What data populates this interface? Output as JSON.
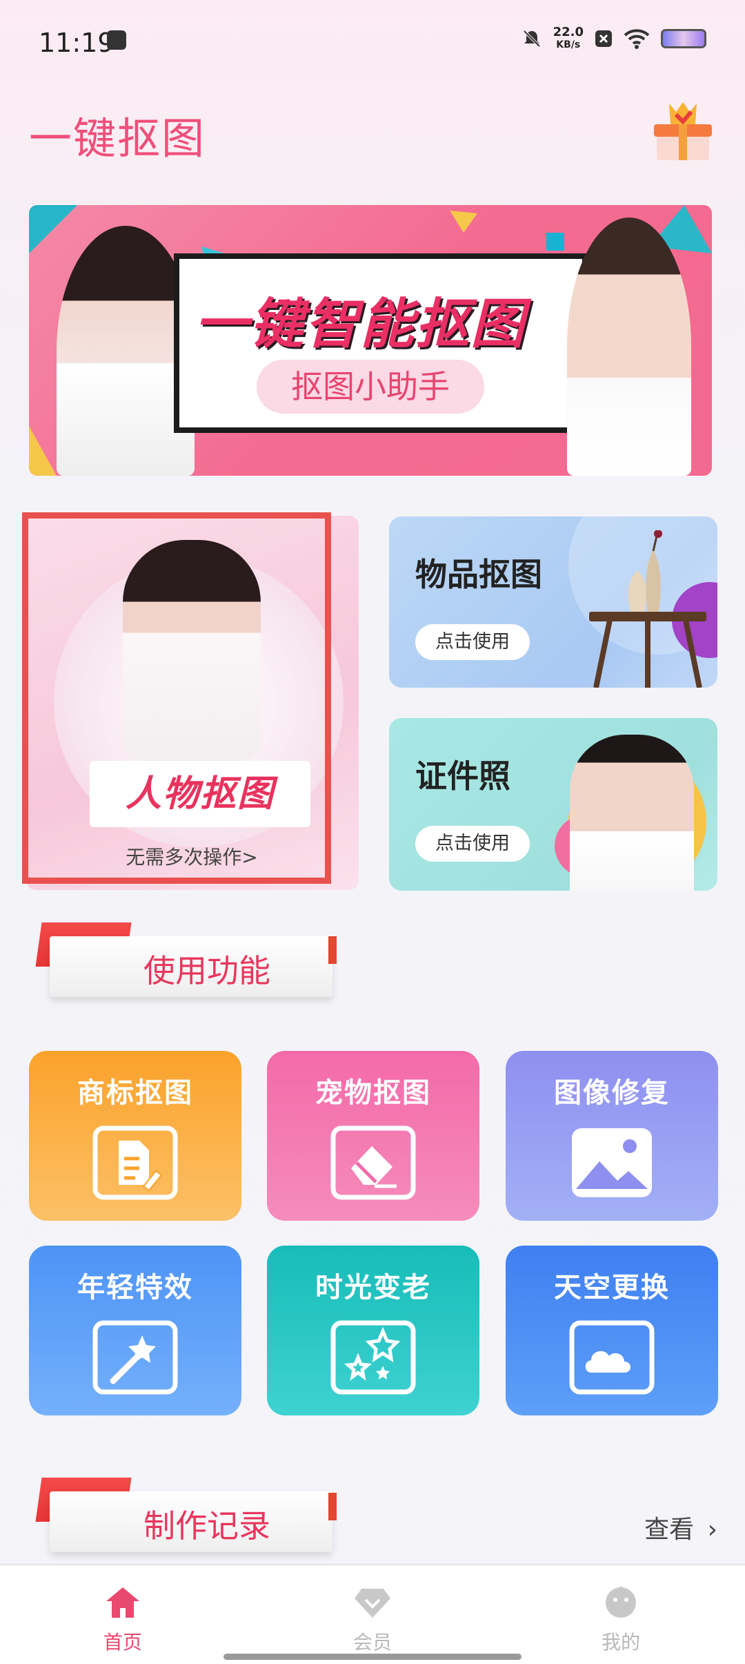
{
  "status_bar": {
    "time": "11:19",
    "net_speed_value": "22.0",
    "net_speed_unit": "KB/s"
  },
  "header": {
    "title": "一键抠图"
  },
  "banner": {
    "headline": "一键智能抠图",
    "pill": "抠图小助手"
  },
  "cards": {
    "portrait": {
      "title": "人物抠图",
      "subtitle": "无需多次操作>"
    },
    "object": {
      "title": "物品抠图",
      "action": "点击使用"
    },
    "id_photo": {
      "title": "证件照",
      "action": "点击使用"
    }
  },
  "sections": {
    "functions": "使用功能",
    "records": "制作记录",
    "view_more": "查看"
  },
  "tiles": [
    {
      "label": "商标抠图",
      "icon": "document-edit-icon",
      "color": "#fbb04a"
    },
    {
      "label": "宠物抠图",
      "icon": "eraser-icon",
      "color": "#f27eb4"
    },
    {
      "label": "图像修复",
      "icon": "image-icon",
      "color": "#8f99f2"
    },
    {
      "label": "年轻特效",
      "icon": "magic-wand-icon",
      "color": "#5e9ff8"
    },
    {
      "label": "时光变老",
      "icon": "stars-icon",
      "color": "#2ccbc8"
    },
    {
      "label": "天空更换",
      "icon": "cloud-icon",
      "color": "#4e8ff4"
    }
  ],
  "bottom_nav": [
    {
      "label": "首页",
      "icon": "home-icon",
      "active": true
    },
    {
      "label": "会员",
      "icon": "diamond-icon",
      "active": false
    },
    {
      "label": "我的",
      "icon": "profile-icon",
      "active": false
    }
  ],
  "colors": {
    "accent": "#ef4f7a",
    "nav_active": "#e9486f",
    "nav_inactive": "#b9b9b9"
  }
}
